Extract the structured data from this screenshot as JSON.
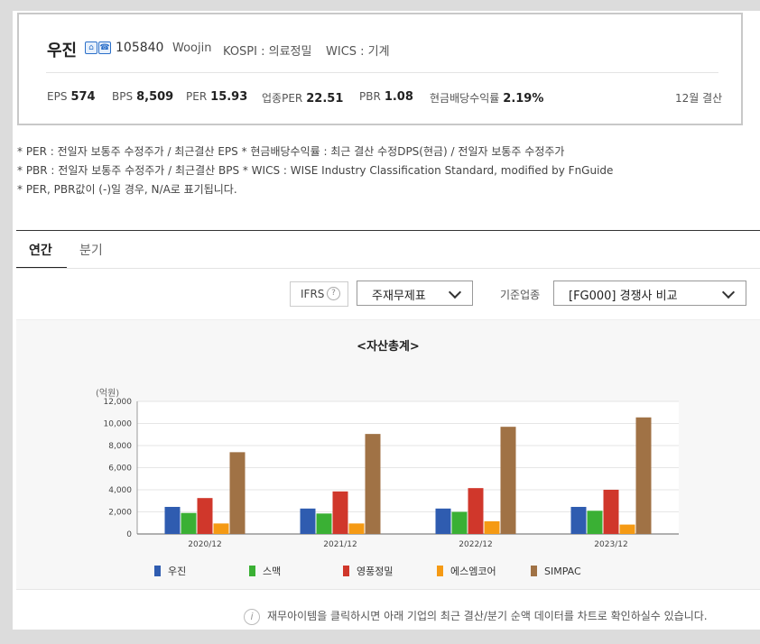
{
  "company": {
    "name": "우진",
    "code": "105840",
    "english_name": "Woojin",
    "market": "KOSPI : 의료정밀",
    "wics": "WICS : 기계",
    "settlement": "12월 결산"
  },
  "metrics": [
    {
      "label": "EPS",
      "value": "574"
    },
    {
      "label": "BPS",
      "value": "8,509"
    },
    {
      "label": "PER",
      "value": "15.93"
    },
    {
      "label": "업종PER",
      "value": "22.51"
    },
    {
      "label": "PBR",
      "value": "1.08"
    },
    {
      "label": "현금배당수익률",
      "value": "2.19%"
    }
  ],
  "notes": [
    "* PER : 전일자 보통주 수정주가 / 최근결산 EPS * 현금배당수익률 : 최근 결산 수정DPS(현금) / 전일자 보통주 수정주가",
    "* PBR : 전일자 보통주 수정주가 / 최근결산 BPS * WICS : WISE Industry Classification Standard, modified by FnGuide",
    "* PER, PBR값이 (-)일 경우, N/A로 표기됩니다."
  ],
  "tabs": {
    "annual": "연간",
    "quarter": "분기"
  },
  "controls": {
    "ifrs_label": "IFRS",
    "help": "?",
    "statement_select": "주재무제표",
    "industry_label": "기준업종",
    "industry_select": "[FG000] 경쟁사 비교"
  },
  "chart_data": {
    "type": "bar",
    "title": "<자산총계>",
    "unit_label": "(억원)",
    "categories": [
      "2020/12",
      "2021/12",
      "2022/12",
      "2023/12"
    ],
    "ylim": [
      0,
      12000
    ],
    "yticks": [
      "0",
      "2,000",
      "4,000",
      "6,000",
      "8,000",
      "10,000",
      "12,000"
    ],
    "legend_position": "bottom",
    "series": [
      {
        "name": "우진",
        "color": "#2f5cb0",
        "values": [
          2450,
          2300,
          2300,
          2450
        ]
      },
      {
        "name": "스맥",
        "color": "#3ab034",
        "values": [
          1900,
          1850,
          2000,
          2100
        ]
      },
      {
        "name": "영풍정밀",
        "color": "#d0372b",
        "values": [
          3250,
          3850,
          4150,
          4000
        ]
      },
      {
        "name": "에스엠코어",
        "color": "#f59a14",
        "values": [
          950,
          950,
          1150,
          850
        ]
      },
      {
        "name": "SIMPAC",
        "color": "#a07245",
        "values": [
          7400,
          9050,
          9700,
          10550
        ]
      }
    ]
  },
  "info_text": "재무아이템을 클릭하시면 아래 기업의 최근 결산/분기 순액 데이터를 차트로 확인하실수 있습니다."
}
